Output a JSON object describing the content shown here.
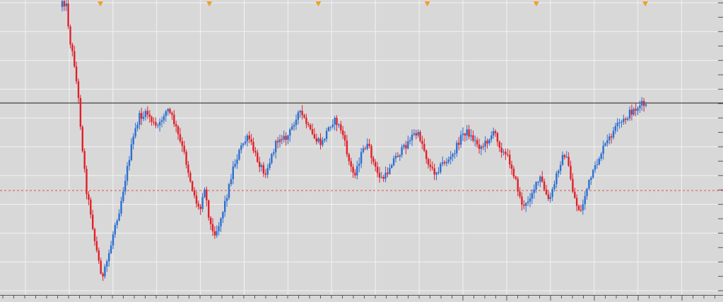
{
  "chart_data": {
    "type": "candlestick",
    "title": "",
    "xlabel": "",
    "ylabel": "",
    "grid": true,
    "ylim": [
      0,
      428
    ],
    "colors": {
      "background": "#d8d8d8",
      "grid": "#f2f2f2",
      "bull": "#2b6fd1",
      "bear": "#e0202a",
      "reference_line": "#1a1a1a",
      "dashed_line": "#e05050",
      "marker": "#f0a020",
      "axis": "#555555"
    },
    "reference_line_value": 146,
    "dashed_line_value": 270,
    "event_marker_count": 6,
    "path_points": [
      [
        0,
        0
      ],
      [
        0.5,
        8
      ],
      [
        1.0,
        60
      ],
      [
        1.5,
        90
      ],
      [
        2.0,
        140
      ],
      [
        2.5,
        210
      ],
      [
        3.0,
        270
      ],
      [
        3.5,
        300
      ],
      [
        4.0,
        340
      ],
      [
        4.5,
        370
      ],
      [
        5.0,
        395
      ],
      [
        5.5,
        372
      ],
      [
        6.0,
        348
      ],
      [
        6.5,
        318
      ],
      [
        7.0,
        300
      ],
      [
        7.5,
        270
      ],
      [
        8.0,
        240
      ],
      [
        8.5,
        210
      ],
      [
        9.0,
        185
      ],
      [
        9.5,
        165
      ],
      [
        10.0,
        165
      ],
      [
        10.5,
        160
      ],
      [
        11.0,
        170
      ],
      [
        11.5,
        180
      ],
      [
        12.0,
        178
      ],
      [
        12.5,
        162
      ],
      [
        13.0,
        155
      ],
      [
        13.5,
        165
      ],
      [
        14.0,
        180
      ],
      [
        14.5,
        200
      ],
      [
        15.0,
        215
      ],
      [
        15.5,
        240
      ],
      [
        16.0,
        265
      ],
      [
        16.5,
        285
      ],
      [
        17.0,
        300
      ],
      [
        17.5,
        260
      ],
      [
        18.0,
        300
      ],
      [
        18.5,
        330
      ],
      [
        19.0,
        328
      ],
      [
        19.5,
        312
      ],
      [
        20.0,
        290
      ],
      [
        20.5,
        268
      ],
      [
        21.0,
        240
      ],
      [
        21.5,
        225
      ],
      [
        22.0,
        210
      ],
      [
        22.5,
        200
      ],
      [
        23.0,
        195
      ],
      [
        23.5,
        210
      ],
      [
        24.0,
        225
      ],
      [
        24.5,
        235
      ],
      [
        25.0,
        245
      ],
      [
        25.5,
        232
      ],
      [
        26.0,
        215
      ],
      [
        26.5,
        200
      ],
      [
        27.0,
        192
      ],
      [
        27.5,
        198
      ],
      [
        28.0,
        190
      ],
      [
        28.5,
        176
      ],
      [
        29.0,
        160
      ],
      [
        29.5,
        162
      ],
      [
        30.0,
        172
      ],
      [
        30.5,
        185
      ],
      [
        31.0,
        195
      ],
      [
        31.5,
        200
      ],
      [
        32.0,
        205
      ],
      [
        32.5,
        190
      ],
      [
        33.0,
        178
      ],
      [
        33.5,
        170
      ],
      [
        34.0,
        176
      ],
      [
        34.5,
        186
      ],
      [
        35.0,
        210
      ],
      [
        35.5,
        235
      ],
      [
        36.0,
        248
      ],
      [
        36.5,
        232
      ],
      [
        37.0,
        215
      ],
      [
        37.5,
        205
      ],
      [
        38.0,
        214
      ],
      [
        38.5,
        236
      ],
      [
        39.0,
        248
      ],
      [
        39.5,
        254
      ],
      [
        40.0,
        248
      ],
      [
        40.5,
        232
      ],
      [
        41.0,
        224
      ],
      [
        41.5,
        218
      ],
      [
        42.0,
        212
      ],
      [
        42.5,
        204
      ],
      [
        43.0,
        194
      ],
      [
        43.5,
        190
      ],
      [
        44.0,
        192
      ],
      [
        44.5,
        206
      ],
      [
        45.0,
        226
      ],
      [
        45.5,
        240
      ],
      [
        46.0,
        244
      ],
      [
        46.5,
        238
      ],
      [
        47.0,
        230
      ],
      [
        47.5,
        228
      ],
      [
        48.0,
        224
      ],
      [
        48.5,
        212
      ],
      [
        49.0,
        198
      ],
      [
        49.5,
        188
      ],
      [
        50.0,
        187
      ],
      [
        50.5,
        195
      ],
      [
        51.0,
        201
      ],
      [
        51.5,
        208
      ],
      [
        52.0,
        206
      ],
      [
        52.5,
        198
      ],
      [
        53.0,
        190
      ],
      [
        53.5,
        190
      ],
      [
        54.0,
        208
      ],
      [
        54.5,
        218
      ],
      [
        55.0,
        224
      ],
      [
        55.5,
        238
      ],
      [
        56.0,
        260
      ],
      [
        56.5,
        282
      ],
      [
        57.0,
        296
      ],
      [
        57.5,
        282
      ],
      [
        58.0,
        270
      ],
      [
        58.5,
        262
      ],
      [
        59.0,
        252
      ],
      [
        59.5,
        270
      ],
      [
        60.0,
        286
      ],
      [
        60.5,
        270
      ],
      [
        61.0,
        246
      ],
      [
        61.5,
        228
      ],
      [
        62.0,
        218
      ],
      [
        62.5,
        238
      ],
      [
        63.0,
        272
      ],
      [
        63.5,
        292
      ],
      [
        64.0,
        300
      ],
      [
        64.5,
        275
      ],
      [
        65.0,
        258
      ],
      [
        65.5,
        245
      ],
      [
        66.0,
        230
      ],
      [
        66.5,
        215
      ],
      [
        67.0,
        205
      ],
      [
        67.5,
        196
      ],
      [
        68.0,
        186
      ],
      [
        68.5,
        178
      ],
      [
        69.0,
        174
      ],
      [
        69.5,
        168
      ],
      [
        70.0,
        160
      ],
      [
        70.5,
        156
      ],
      [
        71.0,
        152
      ],
      [
        71.5,
        148
      ],
      [
        72.0,
        150
      ]
    ]
  }
}
